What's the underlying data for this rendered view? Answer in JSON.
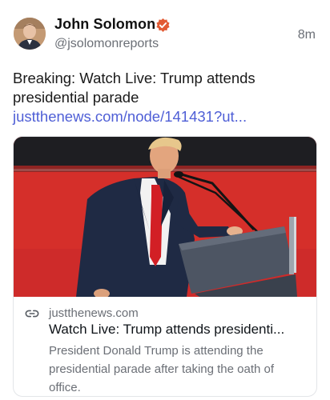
{
  "post": {
    "author_name": "John Solomon",
    "handle": "@jsolomonreports",
    "timestamp": "8m",
    "text": "Breaking: Watch Live: Trump attends presidential parade ",
    "link_text": "justthenews.com/node/141431?ut...",
    "verified_color": "#e25a33"
  },
  "card": {
    "domain": "justthenews.com",
    "title": "Watch Live: Trump attends presidenti...",
    "description": "President Donald Trump is attending the presidential parade after taking the oath of office."
  },
  "icons": {
    "avatar": "profile-photo",
    "verified": "verified-badge-icon",
    "link": "link-icon"
  }
}
